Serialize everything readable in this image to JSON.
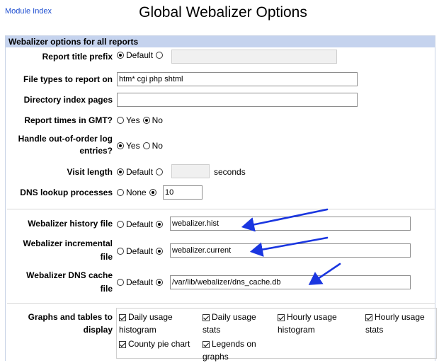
{
  "header": {
    "module_index": "Module Index",
    "title": "Global Webalizer Options"
  },
  "panel": {
    "title": "Webalizer options for all reports"
  },
  "options": {
    "report_title_prefix": {
      "label": "Report title prefix",
      "default": "Default"
    },
    "file_types": {
      "label": "File types to report on",
      "value": "htm* cgi php shtml"
    },
    "directory_index": {
      "label": "Directory index pages",
      "value": ""
    },
    "report_times_gmt": {
      "label": "Report times in GMT?",
      "yes": "Yes",
      "no": "No"
    },
    "out_of_order": {
      "label_line1": "Handle out-of-order log",
      "label_line2": "entries?",
      "yes": "Yes",
      "no": "No"
    },
    "visit_length": {
      "label": "Visit length",
      "default": "Default",
      "unit": "seconds"
    },
    "dns_processes": {
      "label": "DNS lookup processes",
      "none": "None",
      "value": "10"
    },
    "history_file": {
      "label": "Webalizer history file",
      "default": "Default",
      "value": "webalizer.hist"
    },
    "incremental_file": {
      "label_line1": "Webalizer incremental",
      "label_line2": "file",
      "default": "Default",
      "value": "webalizer.current"
    },
    "dns_cache_file": {
      "label_line1": "Webalizer DNS cache",
      "label_line2": "file",
      "default": "Default",
      "value": "/var/lib/webalizer/dns_cache.db"
    },
    "graphs": {
      "label_line1": "Graphs and tables to",
      "label_line2": "display",
      "items": [
        {
          "line1": "Daily usage",
          "line2": "histogram",
          "checked": true
        },
        {
          "line1": "Daily usage",
          "line2": "stats",
          "checked": true
        },
        {
          "line1": "Hourly usage",
          "line2": "histogram",
          "checked": true
        },
        {
          "line1": "Hourly usage",
          "line2": "stats",
          "checked": true
        },
        {
          "line1": "County pie chart",
          "line2": "",
          "checked": true
        },
        {
          "line1": "Legends on",
          "line2": "graphs",
          "checked": true
        }
      ]
    }
  },
  "annotation": {
    "arrow_color": "#1a36e0"
  }
}
